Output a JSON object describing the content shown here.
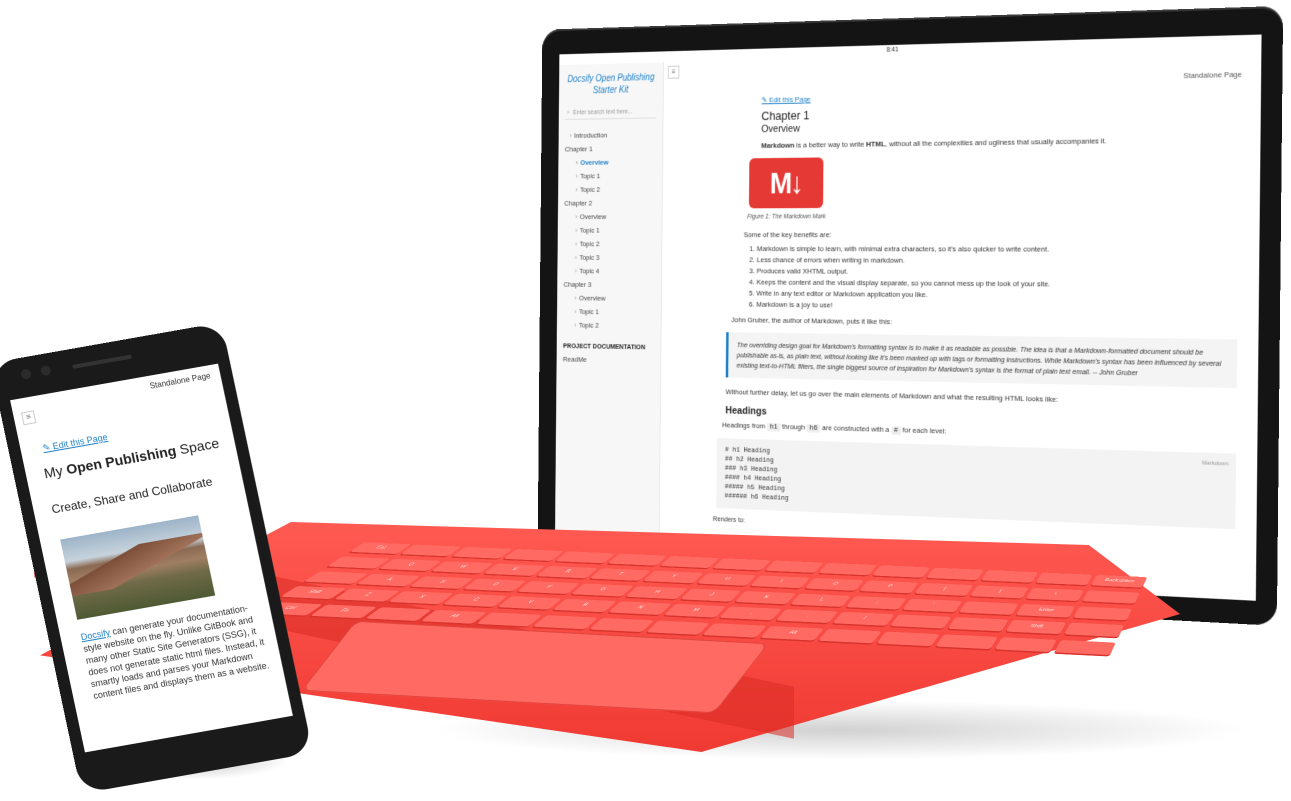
{
  "tablet": {
    "status_time": "8:41",
    "app_title": "Docsify Open Publishing Starter Kit",
    "search": {
      "placeholder": "Enter search text here..."
    },
    "nav": [
      {
        "label": "Introduction",
        "kind": "sub0"
      },
      {
        "label": "Chapter 1",
        "kind": "chapter"
      },
      {
        "label": "Overview",
        "kind": "sub",
        "active": true
      },
      {
        "label": "Topic 1",
        "kind": "sub"
      },
      {
        "label": "Topic 2",
        "kind": "sub"
      },
      {
        "label": "Chapter 2",
        "kind": "chapter"
      },
      {
        "label": "Overview",
        "kind": "sub"
      },
      {
        "label": "Topic 1",
        "kind": "sub"
      },
      {
        "label": "Topic 2",
        "kind": "sub"
      },
      {
        "label": "Topic 3",
        "kind": "sub"
      },
      {
        "label": "Topic 4",
        "kind": "sub"
      },
      {
        "label": "Chapter 3",
        "kind": "chapter"
      },
      {
        "label": "Overview",
        "kind": "sub"
      },
      {
        "label": "Topic 1",
        "kind": "sub"
      },
      {
        "label": "Topic 2",
        "kind": "sub"
      }
    ],
    "project_heading": "PROJECT DOCUMENTATION",
    "readme": "ReadMe",
    "standalone": "Standalone Page",
    "edit_link": "Edit this Page",
    "chapter_title": "Chapter 1",
    "overview_title": "Overview",
    "intro_bold1": "Markdown",
    "intro_mid": " is a better way to write ",
    "intro_bold2": "HTML",
    "intro_end": ", without all the complexities and ugliness that usually accompanies it.",
    "logo_text": "M↓",
    "figure_caption": "Figure 1: The Markdown Mark",
    "benefits_intro": "Some of the key benefits are:",
    "benefits": [
      "Markdown is simple to learn, with minimal extra characters, so it's also quicker to write content.",
      "Less chance of errors when writing in markdown.",
      "Produces valid XHTML output.",
      "Keeps the content and the visual display separate, so you cannot mess up the look of your site.",
      "Write in any text editor or Markdown application you like.",
      "Markdown is a joy to use!"
    ],
    "gruber_line": "John Gruber, the author of Markdown, puts it like this:",
    "quote": "The overriding design goal for Markdown's formatting syntax is to make it as readable as possible. The idea is that a Markdown-formatted document should be publishable as-is, as plain text, without looking like it's been marked up with tags or formatting instructions. While Markdown's syntax has been influenced by several existing text-to-HTML filters, the single biggest source of inspiration for Markdown's syntax is the format of plain text email. -- John Gruber",
    "without_delay": "Without further delay, let us go over the main elements of Markdown and what the resulting HTML looks like:",
    "headings_title": "Headings",
    "headings_from": "Headings from ",
    "h1_chip": "h1",
    "through": " through ",
    "h6_chip": "h6",
    "constructed": " are constructed with a ",
    "hash_chip": "#",
    "each_level": " for each level:",
    "code_lang": "Markdown",
    "code_lines": "# h1 Heading\n## h2 Heading\n### h3 Heading\n#### h4 Heading\n##### h5 Heading\n###### h6 Heading",
    "renders_to": "Renders to:"
  },
  "keyboard": {
    "keys": [
      "Esc",
      "",
      "",
      "",
      "",
      "",
      "",
      "",
      "",
      "",
      "",
      "",
      "",
      "",
      "Backspace",
      "",
      "Q",
      "W",
      "E",
      "R",
      "T",
      "Y",
      "U",
      "I",
      "O",
      "P",
      "[",
      "]",
      "\\",
      "",
      "",
      "A",
      "S",
      "D",
      "F",
      "G",
      "H",
      "J",
      "K",
      "L",
      ";",
      "'",
      "",
      "Enter",
      "",
      "Shift",
      "Z",
      "X",
      "C",
      "V",
      "B",
      "N",
      "M",
      ",",
      ".",
      "/",
      "",
      "",
      "Shift",
      "",
      "Ctrl",
      "Fn",
      "",
      "Alt",
      "",
      "",
      "",
      "",
      "",
      "Alt",
      "",
      "",
      "",
      "",
      ""
    ]
  },
  "phone": {
    "standalone": "Standalone Page",
    "edit_link": "Edit this Page",
    "title_prefix": "My ",
    "title_bold": "Open Publishing",
    "title_suffix": " Space",
    "subtitle": "Create, Share and Collaborate",
    "link_word": "Docsify",
    "body": " can generate your documentation-style website on the fly. Unlike GitBook and many other Static Site Generators (SSG), it does not generate static html files. Instead, it smartly loads and parses your Markdown content files and displays them as a website."
  }
}
